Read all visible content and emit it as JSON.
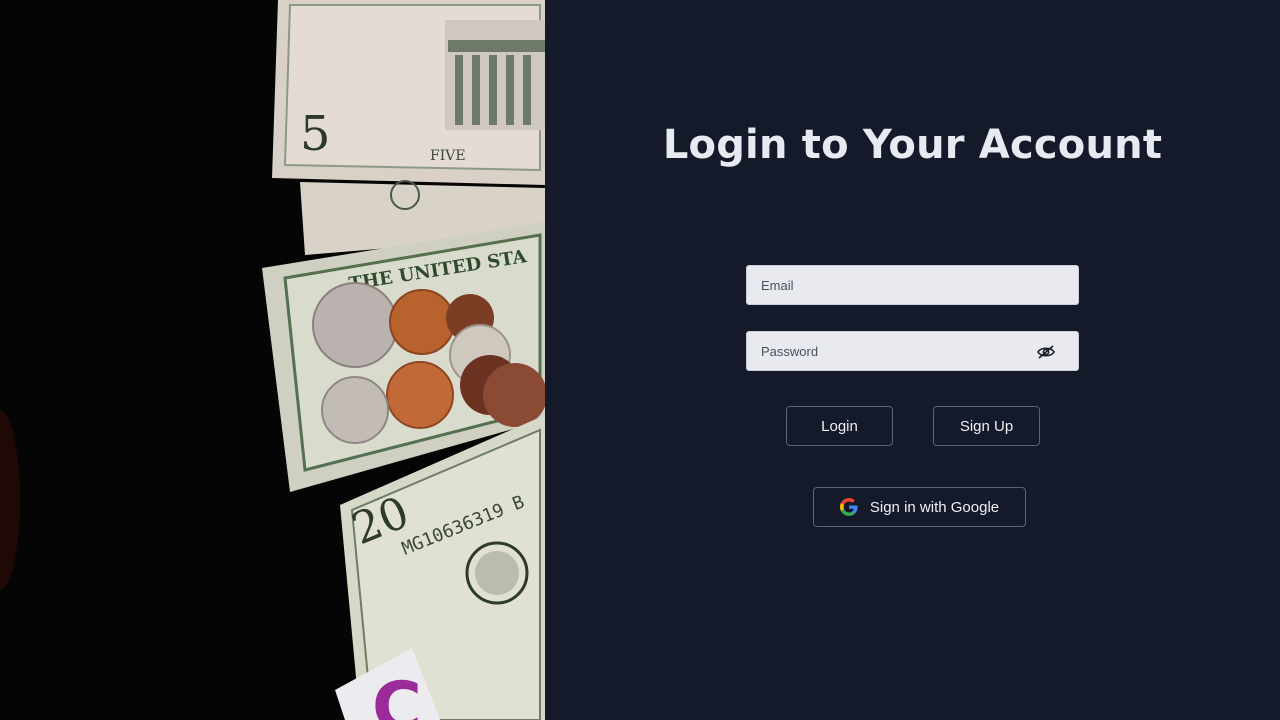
{
  "login": {
    "title": "Login to Your Account",
    "email_placeholder": "Email",
    "email_value": "",
    "password_placeholder": "Password",
    "password_value": "",
    "password_toggle_icon": "eye-slash-icon",
    "login_label": "Login",
    "signup_label": "Sign Up",
    "google_label": "Sign in with Google",
    "google_icon": "google-logo-icon"
  },
  "photo": {
    "description_icon": "money-photo",
    "bill_text_top": "FIVE",
    "bill_text_middle": "THE UNITED STA",
    "bill_text_bottom": "MG10636319 B",
    "bill_denomination_bottom": "20"
  },
  "colors": {
    "panel_bg": "#141a2a",
    "photo_bg": "#050505",
    "input_bg": "#e8eaf0",
    "title_text": "#e7eaf0",
    "button_border": "#5b6272"
  }
}
